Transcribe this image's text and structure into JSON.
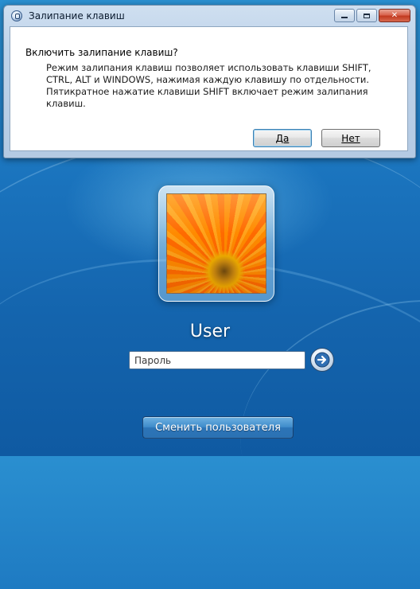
{
  "dialog": {
    "title": "Залипание клавиш",
    "question": "Включить залипание клавиш?",
    "description": "Режим залипания клавиш позволяет использовать клавиши SHIFT, CTRL, ALT и WINDOWS, нажимая каждую клавишу по отдельности. Пятикратное нажатие клавиши SHIFT включает режим залипания клавиш.",
    "yes_label": "Да",
    "no_label": "Нет"
  },
  "logon": {
    "username": "User",
    "password_placeholder": "Пароль",
    "switch_user_label": "Сменить пользователя",
    "accent_color": "#1a73bd"
  },
  "icons": {
    "window_icon": "accessibility-icon",
    "submit": "arrow-right-icon",
    "avatar": "orange-flower-picture"
  }
}
